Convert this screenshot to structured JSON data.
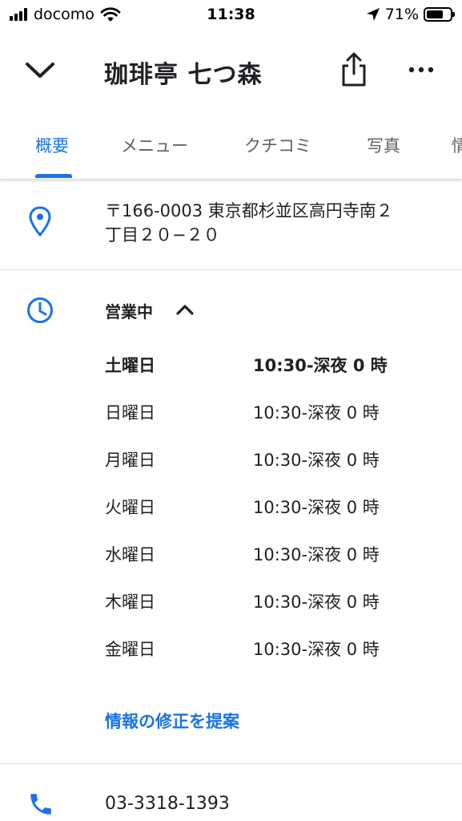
{
  "status_bar": {
    "carrier": "docomo",
    "time": "11:38",
    "battery_percent": "71%",
    "battery_level": 0.71
  },
  "header": {
    "title": "珈琲亭 七つ森",
    "back_icon": "chevron-down-icon",
    "share_icon": "share-icon",
    "more_icon": "more-horiz-icon"
  },
  "tabs": [
    {
      "label": "概要",
      "active": true
    },
    {
      "label": "メニュー",
      "active": false
    },
    {
      "label": "クチコミ",
      "active": false
    },
    {
      "label": "写真",
      "active": false
    },
    {
      "label": "情",
      "active": false
    }
  ],
  "address": {
    "icon": "location-pin-icon",
    "line1": "〒166-0003 東京都杉並区高円寺南２",
    "line2": "丁目２０−２０"
  },
  "hours": {
    "icon": "clock-icon",
    "status": "営業中",
    "rows": [
      {
        "day": "土曜日",
        "time": "10:30-深夜 0 時",
        "today": true
      },
      {
        "day": "日曜日",
        "time": "10:30-深夜 0 時",
        "today": false
      },
      {
        "day": "月曜日",
        "time": "10:30-深夜 0 時",
        "today": false
      },
      {
        "day": "火曜日",
        "time": "10:30-深夜 0 時",
        "today": false
      },
      {
        "day": "水曜日",
        "time": "10:30-深夜 0 時",
        "today": false
      },
      {
        "day": "木曜日",
        "time": "10:30-深夜 0 時",
        "today": false
      },
      {
        "day": "金曜日",
        "time": "10:30-深夜 0 時",
        "today": false
      }
    ],
    "suggest_edit": "情報の修正を提案"
  },
  "phone": {
    "icon": "phone-icon",
    "number": "03-3318-1393"
  },
  "colors": {
    "accent": "#1a73e8",
    "text": "#202124",
    "secondary_text": "#5f6368",
    "divider": "#dadce0"
  }
}
